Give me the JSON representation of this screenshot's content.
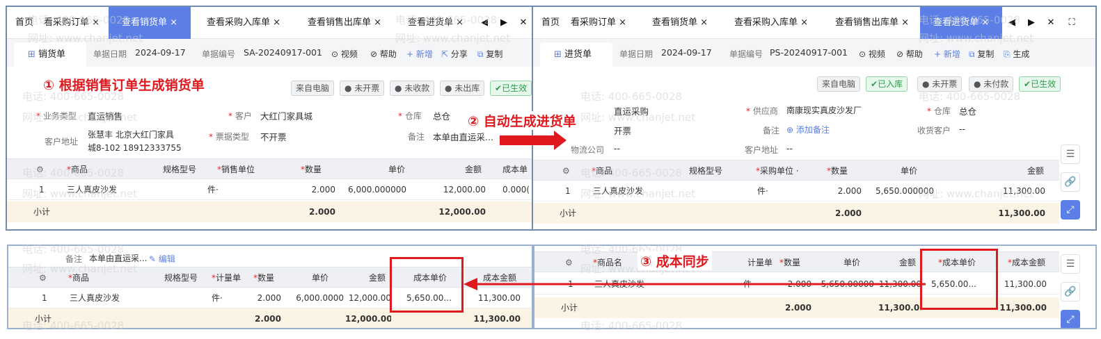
{
  "left_panel": {
    "tabs": [
      "首页",
      "看采购订单 ×",
      "查看销货单 ×",
      "查看采购入库单 ×",
      "查看销售出库单 ×",
      "查看进货单 ×"
    ],
    "controls": [
      "◀",
      "▶",
      "✕"
    ],
    "doc_tab": "销货单",
    "toolbar": {
      "date_label": "单据日期",
      "date": "2024-09-17",
      "no_label": "单据编号",
      "no": "SA-20240917-001",
      "video": "⊙ 视频",
      "help": "⊘ 帮助",
      "add": "+ 新增",
      "share": "分享",
      "copy": "复制"
    },
    "badges": [
      "来自电脑",
      "未开票",
      "未收款",
      "未出库",
      "已生效"
    ],
    "fields": {
      "biz_type_label": "业务类型",
      "biz_type": "直运销售",
      "customer_label": "客户",
      "customer": "大红门家具城",
      "warehouse_label": "仓库",
      "warehouse": "总仓",
      "addr_label": "客户地址",
      "addr_line1": "张慧丰 北京大红门家具",
      "addr_line2": "城8-102 18912333755",
      "invoice_label": "票据类型",
      "invoice": "不开票",
      "remark_label": "备注",
      "remark": "本单由直运采..."
    },
    "table": {
      "headers": [
        "商品",
        "规格型号",
        "销售单位",
        "数量",
        "单价",
        "金额",
        "成本单"
      ],
      "row": [
        "1",
        "三人真皮沙发",
        "件·",
        "2.000",
        "6,000.000000",
        "12,000.00",
        "0.000("
      ],
      "subtotal": [
        "小计",
        "2.000",
        "12,000.00"
      ]
    }
  },
  "right_panel": {
    "tabs": [
      "首页",
      "看采购订单 ×",
      "查看销货单 ×",
      "查看采购入库单 ×",
      "查看销售出库单 ×",
      "查看进货单 ×"
    ],
    "controls": [
      "◀",
      "▶",
      "✕",
      "⛶"
    ],
    "doc_tab": "进货单",
    "toolbar": {
      "date_label": "单据日期",
      "date": "2024-09-17",
      "no_label": "单据编号",
      "no": "PS-20240917-001",
      "video": "⊙ 视频",
      "help": "⊘ 帮助",
      "add": "+ 新增",
      "copy": "复制",
      "gen": "生成"
    },
    "badges": [
      "来自电脑",
      "已入库",
      "未开票",
      "未付款",
      "已生效"
    ],
    "fields": {
      "biz_type": "直运采购",
      "supplier_label": "供应商",
      "supplier": "南康现实真皮沙发厂",
      "warehouse_label": "仓库",
      "warehouse": "总仓",
      "invoice": "开票",
      "remark_label": "备注",
      "remark_add": "添加备注",
      "recv_label": "收货客户",
      "recv": "--",
      "logistics_label": "物流公司",
      "logistics": "--",
      "addr_label": "客户地址",
      "addr": "--"
    },
    "table": {
      "headers": [
        "商品",
        "规格型号",
        "采购单位 ·",
        "数量",
        "单价",
        "金额"
      ],
      "row": [
        "1",
        "三人真皮沙发",
        "件·",
        "2.000",
        "5,650.000000",
        "11,300.00"
      ],
      "subtotal": [
        "小计",
        "2.000",
        "11,300.00"
      ]
    }
  },
  "bottom_left": {
    "remark_label": "备注",
    "remark": "本单由直运采...",
    "edit": "编辑",
    "headers": [
      "商品",
      "规格型号",
      "计量单",
      "数量",
      "单价",
      "金额",
      "成本单价",
      "成本金额"
    ],
    "row": [
      "1",
      "三人真皮沙发",
      "件·",
      "2.000",
      "6,000.0000",
      "12,000.00",
      "5,650.00...",
      "11,300.00"
    ],
    "subtotal": [
      "小计",
      "2.000",
      "12,000.00",
      "11,300.00"
    ]
  },
  "bottom_right": {
    "headers": [
      "商品名",
      "计量单",
      "数量",
      "单价",
      "金额",
      "成本单价",
      "成本金额"
    ],
    "row": [
      "1",
      "三人真皮沙发",
      "件·",
      "2.000",
      "5,650.00000",
      "11,300.00",
      "5,650.00...",
      "11,300.00"
    ],
    "subtotal": [
      "小计",
      "2.000",
      "11,300.00",
      "11,300.00"
    ]
  },
  "annotations": {
    "step1": "① 根据销售订单生成销货单",
    "step2": "② 自动生成进货单",
    "step3": "③ 成本同步"
  },
  "watermark": {
    "phone": "电话: 400-665-0028",
    "site": "网址: www.chanjet.net"
  },
  "colors": {
    "accent": "#5b7fe6",
    "annotation": "#e0191f",
    "subtotal_bg": "#fbf3e4"
  }
}
